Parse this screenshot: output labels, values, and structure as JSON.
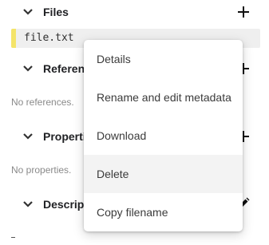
{
  "sections": {
    "files": {
      "title": "Files",
      "icon": "chevron-down-icon",
      "action_icon": "plus-icon"
    },
    "references": {
      "title": "References",
      "empty_text": "No references.",
      "icon": "chevron-down-icon",
      "action_icon": "plus-icon"
    },
    "properties": {
      "title": "Properties",
      "empty_text": "No properties.",
      "icon": "chevron-down-icon",
      "action_icon": "plus-icon"
    },
    "description": {
      "title": "Description",
      "icon": "chevron-down-icon",
      "action_icon": "pencil-icon"
    }
  },
  "file": {
    "name": "file.txt",
    "marker_color": "#f4e46a"
  },
  "context_menu": {
    "items": [
      {
        "label": "Details"
      },
      {
        "label": "Rename and edit metadata"
      },
      {
        "label": "Download"
      },
      {
        "label": "Delete",
        "highlighted": true
      },
      {
        "label": "Copy filename"
      }
    ]
  },
  "colors": {
    "menu_hover": "#f3f3f3",
    "empty_text": "#8a8a8a"
  }
}
